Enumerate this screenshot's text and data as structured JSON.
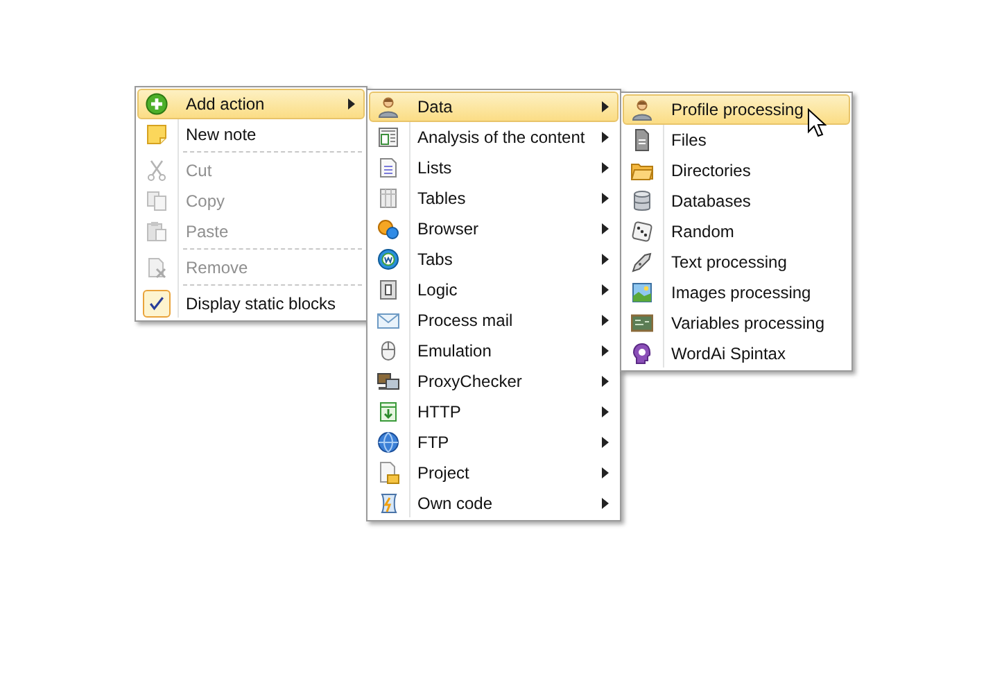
{
  "menus": [
    {
      "items": [
        {
          "kind": "item",
          "label": "Add action",
          "selected": true,
          "disabled": false,
          "submenu": true,
          "checked": false
        },
        {
          "kind": "item",
          "label": "New note",
          "selected": false,
          "disabled": false,
          "submenu": false,
          "checked": false
        },
        {
          "kind": "separator"
        },
        {
          "kind": "item",
          "label": "Cut",
          "selected": false,
          "disabled": true,
          "submenu": false,
          "checked": false
        },
        {
          "kind": "item",
          "label": "Copy",
          "selected": false,
          "disabled": true,
          "submenu": false,
          "checked": false
        },
        {
          "kind": "item",
          "label": "Paste",
          "selected": false,
          "disabled": true,
          "submenu": false,
          "checked": false
        },
        {
          "kind": "separator"
        },
        {
          "kind": "item",
          "label": "Remove",
          "selected": false,
          "disabled": true,
          "submenu": false,
          "checked": false
        },
        {
          "kind": "separator"
        },
        {
          "kind": "item",
          "label": "Display static blocks",
          "selected": false,
          "disabled": false,
          "submenu": false,
          "checked": true
        }
      ]
    },
    {
      "items": [
        {
          "kind": "item",
          "label": "Data",
          "selected": true,
          "disabled": false,
          "submenu": true
        },
        {
          "kind": "item",
          "label": "Analysis of the content",
          "selected": false,
          "disabled": false,
          "submenu": true
        },
        {
          "kind": "item",
          "label": "Lists",
          "selected": false,
          "disabled": false,
          "submenu": true
        },
        {
          "kind": "item",
          "label": "Tables",
          "selected": false,
          "disabled": false,
          "submenu": true
        },
        {
          "kind": "item",
          "label": "Browser",
          "selected": false,
          "disabled": false,
          "submenu": true
        },
        {
          "kind": "item",
          "label": "Tabs",
          "selected": false,
          "disabled": false,
          "submenu": true
        },
        {
          "kind": "item",
          "label": "Logic",
          "selected": false,
          "disabled": false,
          "submenu": true
        },
        {
          "kind": "item",
          "label": "Process mail",
          "selected": false,
          "disabled": false,
          "submenu": true
        },
        {
          "kind": "item",
          "label": "Emulation",
          "selected": false,
          "disabled": false,
          "submenu": true
        },
        {
          "kind": "item",
          "label": "ProxyChecker",
          "selected": false,
          "disabled": false,
          "submenu": true
        },
        {
          "kind": "item",
          "label": "HTTP",
          "selected": false,
          "disabled": false,
          "submenu": true
        },
        {
          "kind": "item",
          "label": "FTP",
          "selected": false,
          "disabled": false,
          "submenu": true
        },
        {
          "kind": "item",
          "label": "Project",
          "selected": false,
          "disabled": false,
          "submenu": true
        },
        {
          "kind": "item",
          "label": "Own code",
          "selected": false,
          "disabled": false,
          "submenu": true
        }
      ]
    },
    {
      "items": [
        {
          "kind": "item",
          "label": "Profile processing",
          "selected": true,
          "disabled": false,
          "submenu": false
        },
        {
          "kind": "item",
          "label": "Files",
          "selected": false,
          "disabled": false,
          "submenu": false
        },
        {
          "kind": "item",
          "label": "Directories",
          "selected": false,
          "disabled": false,
          "submenu": false
        },
        {
          "kind": "item",
          "label": "Databases",
          "selected": false,
          "disabled": false,
          "submenu": false
        },
        {
          "kind": "item",
          "label": "Random",
          "selected": false,
          "disabled": false,
          "submenu": false
        },
        {
          "kind": "item",
          "label": "Text processing",
          "selected": false,
          "disabled": false,
          "submenu": false
        },
        {
          "kind": "item",
          "label": "Images processing",
          "selected": false,
          "disabled": false,
          "submenu": false
        },
        {
          "kind": "item",
          "label": "Variables processing",
          "selected": false,
          "disabled": false,
          "submenu": false
        },
        {
          "kind": "item",
          "label": "WordAi Spintax",
          "selected": false,
          "disabled": false,
          "submenu": false
        }
      ]
    }
  ]
}
